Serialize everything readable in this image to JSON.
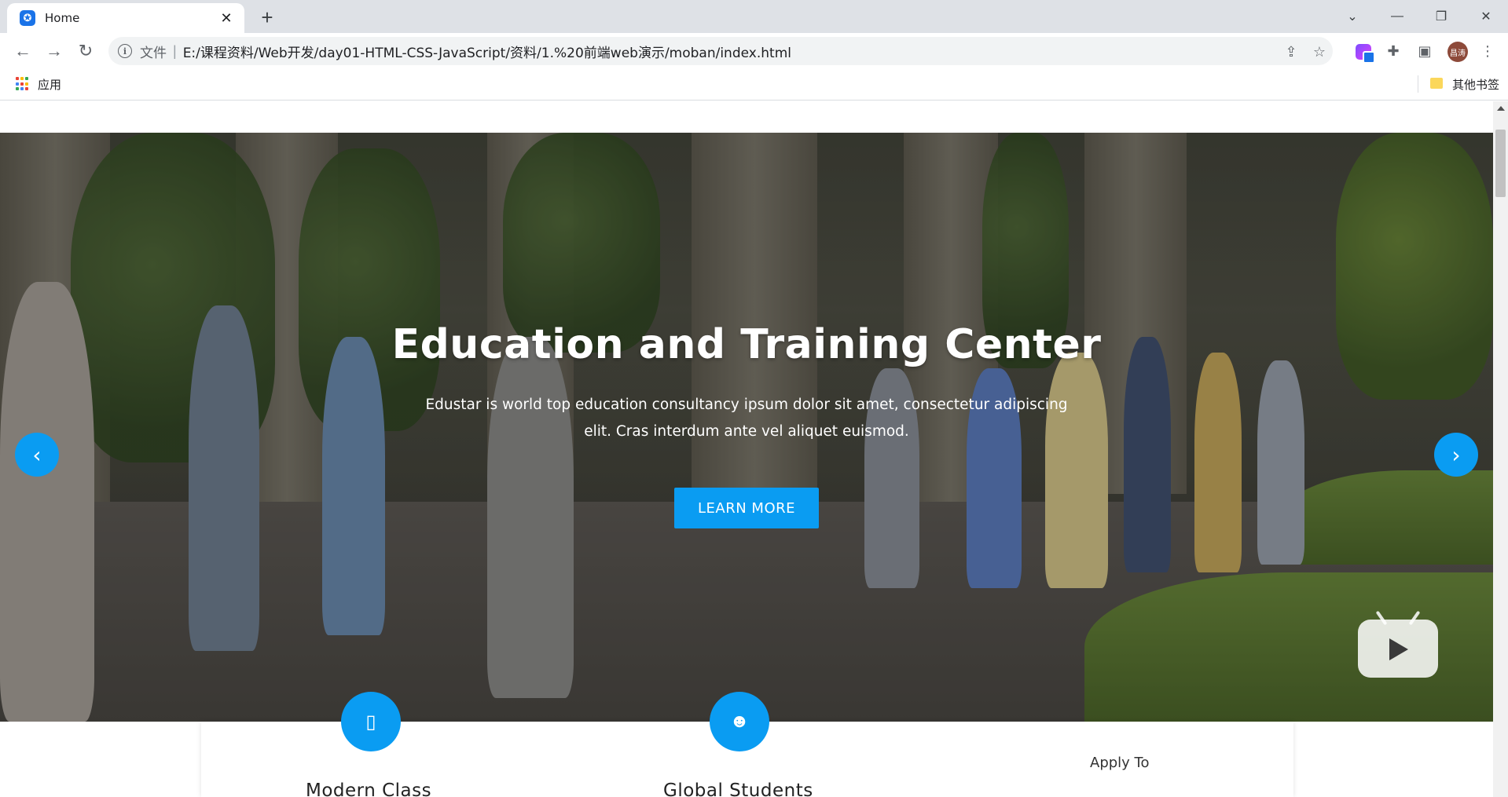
{
  "browser": {
    "tab_title": "Home",
    "file_label": "文件",
    "url": "E:/课程资料/Web开发/day01-HTML-CSS-JavaScript/资料/1.%20前端web演示/moban/index.html",
    "bookmarks": {
      "apps_label": "应用",
      "other_label": "其他书签"
    },
    "avatar_text": "昌涛"
  },
  "hero": {
    "title": "Education and Training Center",
    "subtitle": "Edustar is world top education consultancy ipsum dolor sit amet, consectetur adipiscing elit. Cras interdum ante vel aliquet euismod.",
    "button_label": "LEARN MORE",
    "prev_glyph": "‹",
    "next_glyph": "›"
  },
  "features": [
    {
      "title": "Modern Class",
      "icon": "building-icon"
    },
    {
      "title": "Global Students",
      "icon": "users-icon"
    }
  ],
  "apply_label": "Apply To",
  "colors": {
    "accent": "#0a9cf2",
    "tabstrip": "#dee1e6"
  }
}
